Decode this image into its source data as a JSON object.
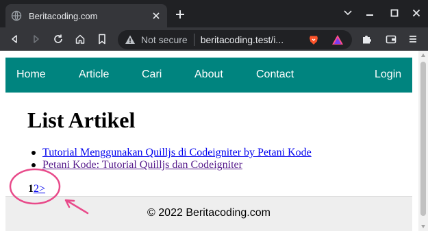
{
  "browser": {
    "tab_title": "Beritacoding.com",
    "security_label": "Not secure",
    "url_display": "beritacoding.test/i..."
  },
  "navbar": {
    "items": [
      "Home",
      "Article",
      "Cari",
      "About",
      "Contact"
    ],
    "login_label": "Login",
    "color": "#00847f"
  },
  "page": {
    "heading": "List Artikel",
    "articles": [
      "Tutorial Menggunakan Quilljs di Codeigniter by Petani Kode",
      "Petani Kode: Tutorial Quilljs dan Codeigniter"
    ]
  },
  "pagination": {
    "current": "1",
    "next_page": "2",
    "next_arrow": ">"
  },
  "footer": {
    "copyright": "© 2022 Beritacoding.com"
  },
  "annotation": {
    "color": "#e84a8a"
  }
}
